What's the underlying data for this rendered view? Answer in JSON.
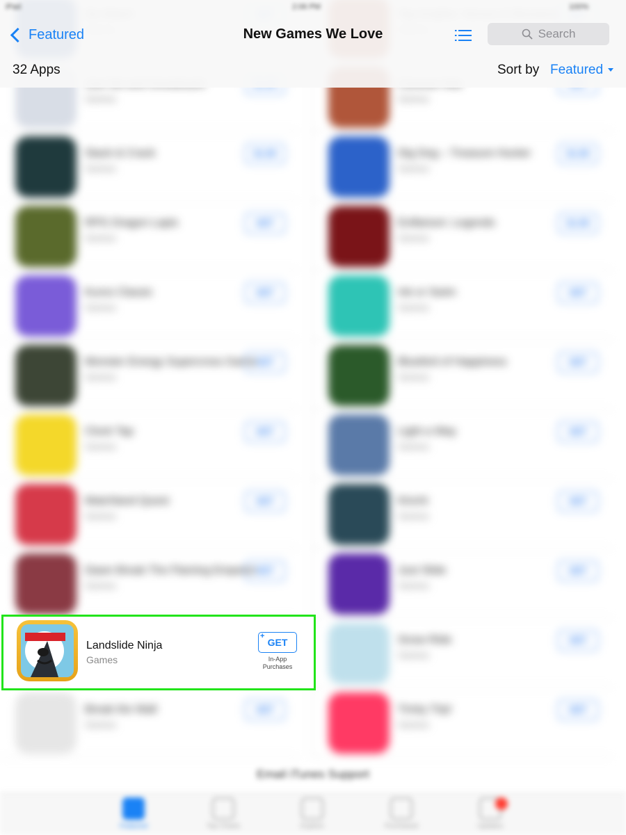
{
  "status_bar": {
    "left": "iPad",
    "time": "2:06 PM",
    "battery": "100%"
  },
  "nav": {
    "back_label": "Featured",
    "title": "New Games We Love",
    "search_placeholder": "Search",
    "app_count": "32 Apps",
    "sort_label": "Sort by",
    "sort_value": "Featured"
  },
  "highlighted_app": {
    "name": "Landslide Ninja",
    "category": "Games",
    "get_label": "GET",
    "iap_line1": "In-App",
    "iap_line2": "Purchases"
  },
  "apps_left": [
    {
      "name": "Six Match",
      "category": "Games",
      "button": "GET",
      "color": "#3a63a8"
    },
    {
      "name": "Just Ski and Snowboard",
      "category": "Games",
      "button": "$1.99",
      "color": "#d8dde6"
    },
    {
      "name": "Stack & Crack",
      "category": "Games",
      "button": "$1.99",
      "color": "#1f3a3d"
    },
    {
      "name": "RPG Dragon Lapis",
      "category": "Games",
      "button": "GET",
      "color": "#5a6a2c"
    },
    {
      "name": "Kuros Classic",
      "category": "Games",
      "button": "GET",
      "color": "#7a5cd8"
    },
    {
      "name": "Monster Energy Supercross Game",
      "category": "Games",
      "button": "GET",
      "color": "#3d4636"
    },
    {
      "name": "Clock Tap",
      "category": "Games",
      "button": "GET",
      "color": "#f4d82a"
    },
    {
      "name": "Matchland Quest",
      "category": "Games",
      "button": "GET",
      "color": "#d63a4a"
    },
    {
      "name": "Dawn Break The Flaming Emperor",
      "category": "Games",
      "button": "GET",
      "color": "#8a3a44"
    },
    {
      "name": "Landslide Ninja",
      "category": "Games",
      "button": "GET",
      "color": "#f2b526"
    },
    {
      "name": "Break the Wall",
      "category": "Games",
      "button": "GET",
      "color": "#e6e6e6"
    }
  ],
  "apps_right": [
    {
      "name": "Tap Knights: Heroes & Monsters",
      "category": "Games",
      "button": "GET",
      "color": "#b85a3a"
    },
    {
      "name": "Caravan War",
      "category": "Games",
      "button": "GET",
      "color": "#b0563a"
    },
    {
      "name": "Dig Dog – Treasure Hunter",
      "category": "Games",
      "button": "$1.99",
      "color": "#2c62c9"
    },
    {
      "name": "Evillarium: Legends",
      "category": "Games",
      "button": "$1.99",
      "color": "#7a1418"
    },
    {
      "name": "Ink or Swim",
      "category": "Games",
      "button": "GET",
      "color": "#2ec4b5"
    },
    {
      "name": "Bluebird of Happiness",
      "category": "Games",
      "button": "GET",
      "color": "#2b5a2a"
    },
    {
      "name": "Light a Way",
      "category": "Games",
      "button": "GET",
      "color": "#5a7aa8"
    },
    {
      "name": "Kinchi",
      "category": "Games",
      "button": "GET",
      "color": "#2a4a58"
    },
    {
      "name": "Just Slide",
      "category": "Games",
      "button": "GET",
      "color": "#5a2aa8"
    },
    {
      "name": "Snow Ride",
      "category": "Games",
      "button": "GET",
      "color": "#bfe0ec"
    },
    {
      "name": "Tricky Trip!",
      "category": "Games",
      "button": "GET",
      "color": "#ff3a64"
    }
  ],
  "footer_link": "Email iTunes Support",
  "tabs": [
    {
      "label": "Featured",
      "active": true
    },
    {
      "label": "Top Charts"
    },
    {
      "label": "Explore"
    },
    {
      "label": "Purchased"
    },
    {
      "label": "Updates"
    }
  ]
}
